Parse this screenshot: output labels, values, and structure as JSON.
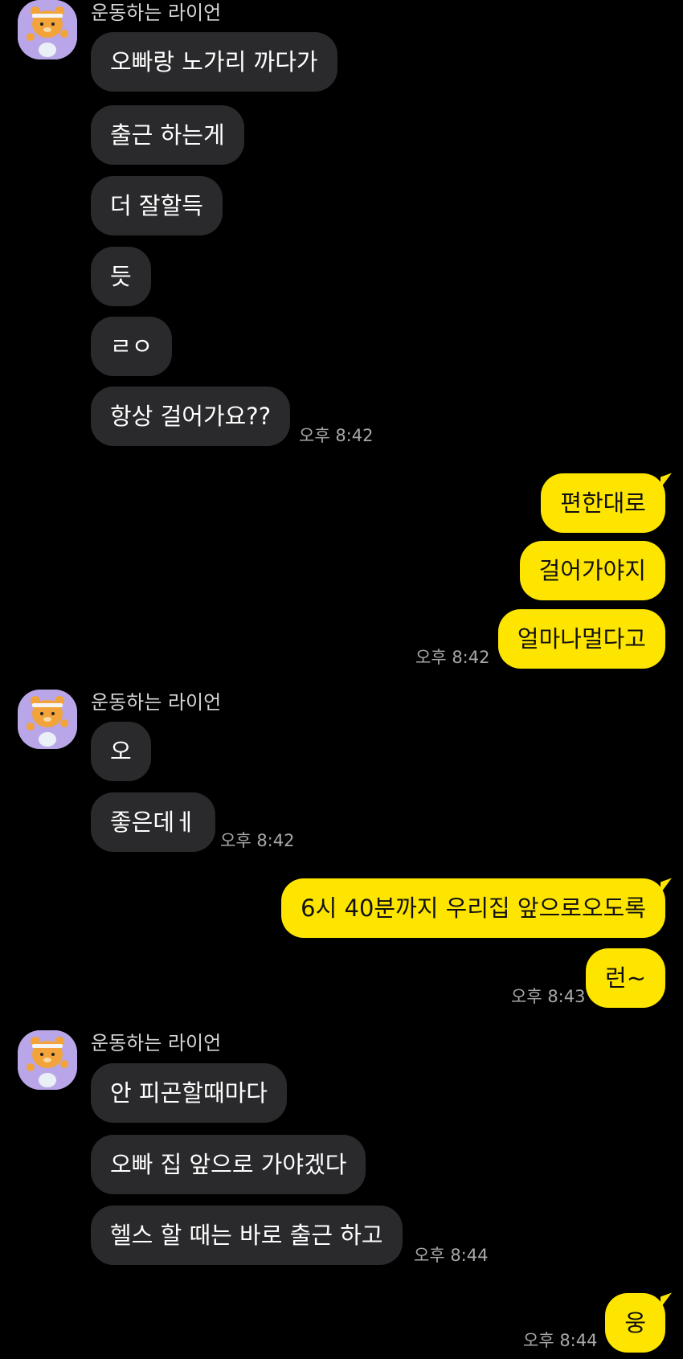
{
  "sender_name": "운동하는 라이언",
  "colors": {
    "background": "#000000",
    "incoming_bubble": "#2a2a2c",
    "outgoing_bubble": "#fee500",
    "avatar_bg": "#b9a6e8"
  },
  "icons": {
    "avatar": "ryan-character-avatar-icon"
  },
  "group1": {
    "messages": [
      "오빠랑 노가리 까다가",
      "출근 하는게",
      "더 잘할득",
      "듯",
      "ㄹㅇ",
      "항상 걸어가요??"
    ],
    "time": "오후 8:42"
  },
  "group2": {
    "messages": [
      "편한대로",
      "걸어가야지",
      "얼마나멀다고"
    ],
    "time": "오후 8:42"
  },
  "group3": {
    "messages": [
      "오",
      "좋은데ㅔ"
    ],
    "time": "오후 8:42"
  },
  "group4": {
    "messages": [
      "6시 40분까지 우리집 앞으로오도록",
      "런~"
    ],
    "time": "오후 8:43"
  },
  "group5": {
    "messages": [
      "안 피곤할때마다",
      "오빠 집 앞으로 가야겠다",
      "헬스 할 때는 바로 출근 하고"
    ],
    "time": "오후 8:44"
  },
  "group6": {
    "messages": [
      "웅"
    ],
    "time": "오후 8:44"
  }
}
